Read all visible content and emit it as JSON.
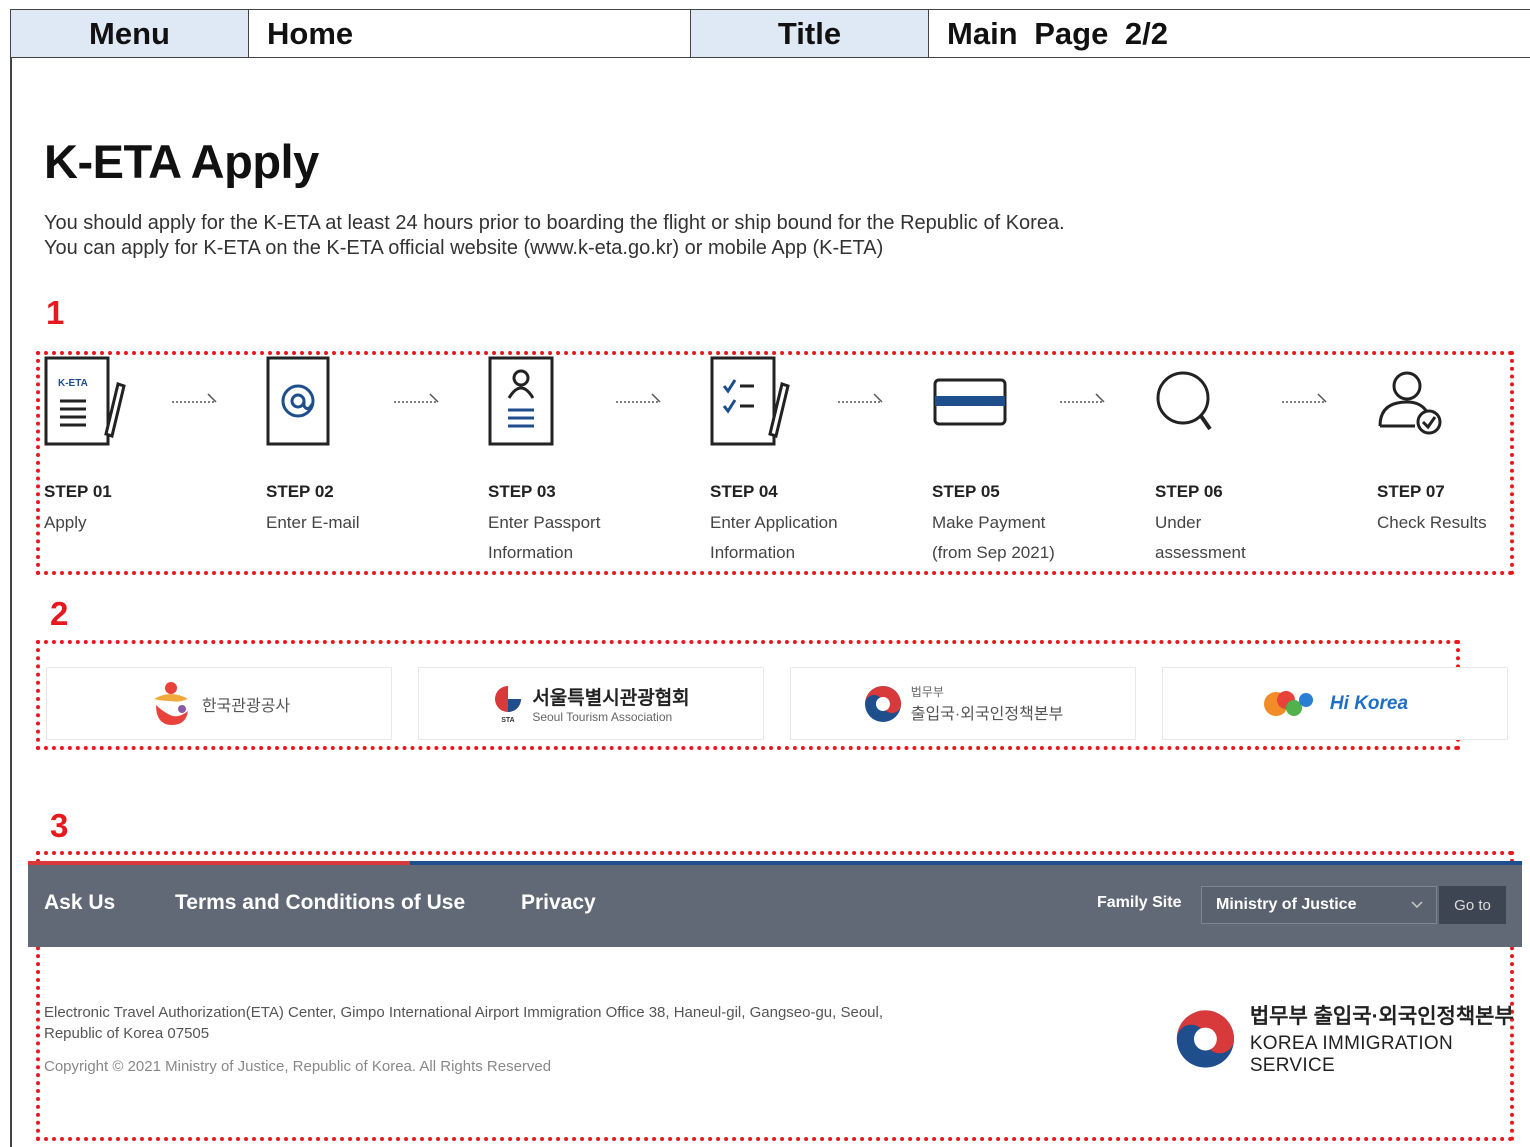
{
  "header": {
    "menu_label": "Menu",
    "menu_value": "Home",
    "title_label": "Title",
    "title_value": "Main Page 2/2"
  },
  "page": {
    "title": "K-ETA Apply",
    "desc_line1": "You should apply for the K-ETA at least 24 hours prior to boarding the flight or ship bound for the Republic of Korea.",
    "desc_line2": "You can apply for K-ETA on the K-ETA official website (www.k-eta.go.kr) or mobile App (K-ETA)"
  },
  "markers": [
    "1",
    "2",
    "3"
  ],
  "steps": [
    {
      "num": "STEP 01",
      "label_lines": [
        "Apply"
      ],
      "icon": "application-form-icon",
      "icon_text": "K-ETA"
    },
    {
      "num": "STEP 02",
      "label_lines": [
        "Enter E-mail"
      ],
      "icon": "email-icon"
    },
    {
      "num": "STEP 03",
      "label_lines": [
        "Enter Passport",
        "Information"
      ],
      "icon": "passport-icon"
    },
    {
      "num": "STEP 04",
      "label_lines": [
        "Enter Application",
        "Information"
      ],
      "icon": "checklist-icon"
    },
    {
      "num": "STEP 05",
      "label_lines": [
        "Make Payment",
        "(from Sep 2021)"
      ],
      "icon": "credit-card-icon"
    },
    {
      "num": "STEP 06",
      "label_lines": [
        "Under",
        "assessment"
      ],
      "icon": "magnifier-icon"
    },
    {
      "num": "STEP 07",
      "label_lines": [
        "Check Results"
      ],
      "icon": "user-check-icon"
    }
  ],
  "partners": [
    {
      "name": "한국관광공사",
      "icon": "kto-logo-icon"
    },
    {
      "name": "서울특별시관광협회",
      "sub": "Seoul Tourism Association",
      "badge": "STA",
      "icon": "sta-logo-icon"
    },
    {
      "name": "출입국·외국인정책본부",
      "pre": "법무부",
      "icon": "taegeuk-logo-icon"
    },
    {
      "name": "Hi Korea",
      "icon": "hikorea-logo-icon"
    }
  ],
  "footer": {
    "links": [
      "Ask Us",
      "Terms and Conditions of Use",
      "Privacy"
    ],
    "family_site_label": "Family Site",
    "family_site_value": "Ministry of Justice",
    "go_button": "Go to",
    "address_line1": "Electronic Travel Authorization(ETA) Center, Gimpo International Airport Immigration Office 38, Haneul-gil, Gangseo-gu, Seoul,",
    "address_line2": "Republic of Korea 07505",
    "copyright": "Copyright © 2021 Ministry of Justice, Republic of Korea. All Rights Reserved",
    "org_name_ko": "법무부 출입국·외국인정책본부",
    "org_name_en": "KOREA IMMIGRATION SERVICE"
  },
  "colors": {
    "header_label_bg": "#dfe9f5",
    "marker_red": "#e8191c",
    "footer_bar": "#616977",
    "accent_blue": "#1f4e8c",
    "accent_red": "#d8393a"
  }
}
